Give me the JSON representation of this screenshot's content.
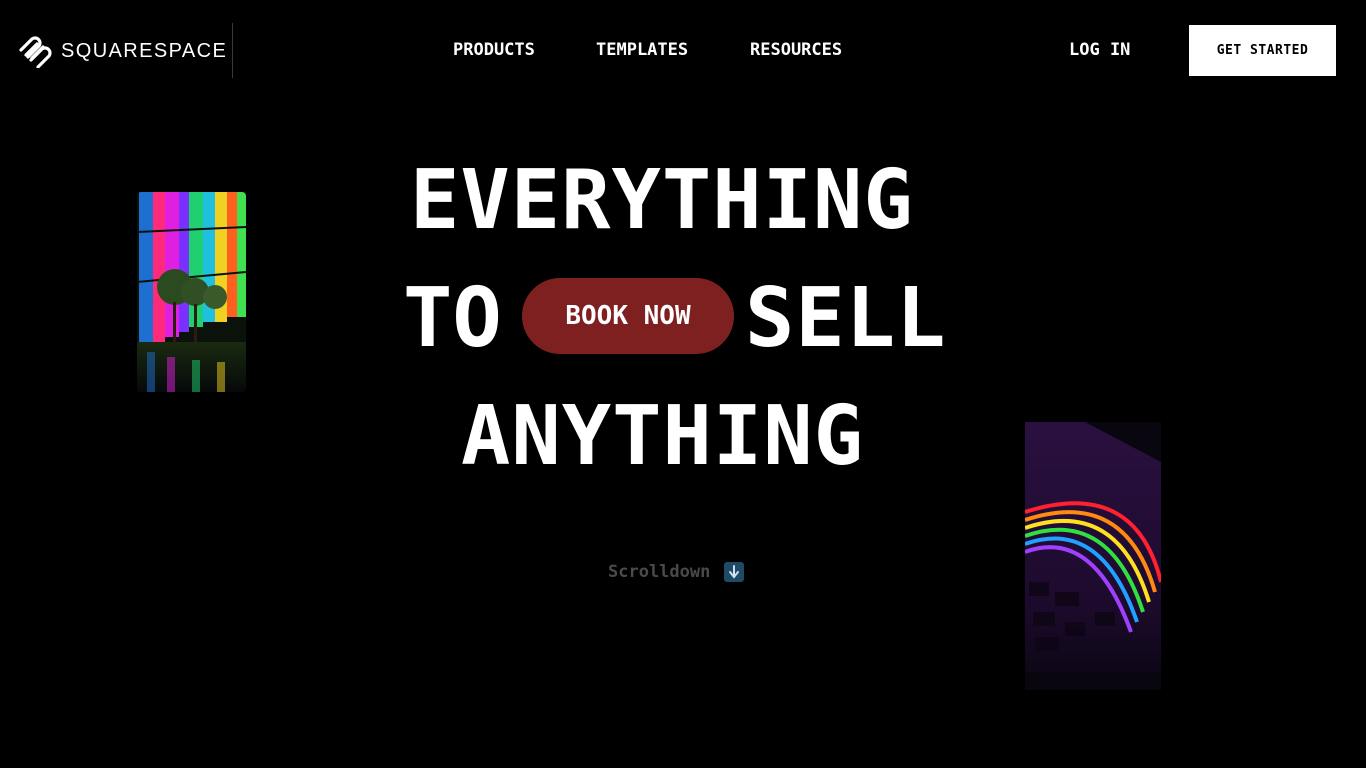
{
  "header": {
    "brand": "SQUARESPACE",
    "logo_icon": "squarespace-logo-icon",
    "nav": {
      "products": "PRODUCTS",
      "templates": "TEMPLATES",
      "resources": "RESOURCES"
    },
    "login": "LOG IN",
    "get_started": "GET STARTED"
  },
  "hero": {
    "line1": "EVERYTHING",
    "line2_start": "TO",
    "book_now": "BOOK NOW",
    "line2_end": "SELL",
    "line3": "ANYTHING",
    "book_now_color": "#7f2020"
  },
  "scroll": {
    "label": "Scrolldown",
    "icon": "down-arrow-icon"
  },
  "images": {
    "left_icon": "colorful-building-photo",
    "right_icon": "neon-rainbow-wall-photo"
  }
}
